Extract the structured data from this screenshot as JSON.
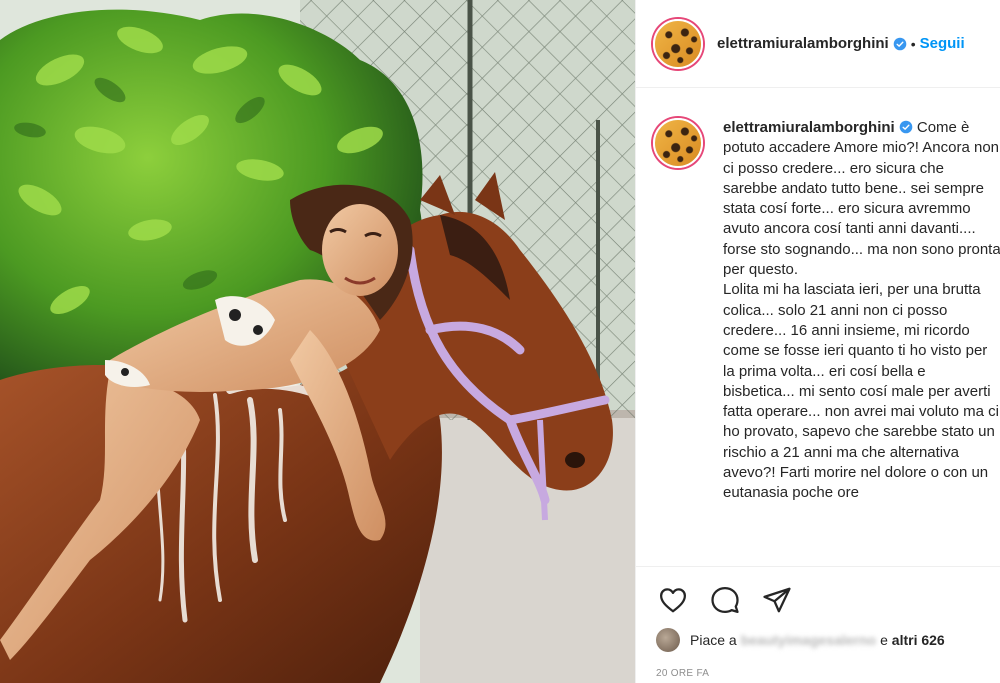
{
  "post": {
    "username": "elettramiuralamborghini",
    "separator": "•",
    "follow_label": "Seguii",
    "caption": "Come è potuto accadere Amore mio?! Ancora non ci posso credere... ero sicura che sarebbe andato tutto bene.. sei sempre stata cosí forte... ero sicura avremmo avuto ancora cosí tanti anni davanti.... forse sto sognando... ma non sono pronta per questo.\nLolita mi ha lasciata ieri, per una brutta colica... solo 21 anni non ci posso credere... 16 anni insieme, mi ricordo come se fosse ieri quanto ti ho visto per la prima volta... eri cosí bella e bisbetica... mi sento cosí male per averti fatta operare... non avrei mai voluto ma ci ho provato, sapevo che sarebbe stato un rischio a 21 anni ma che alternativa avevo?! Farti morire nel dolore o con un eutanasia poche ore",
    "likes": {
      "prefix": "Piace a",
      "liker": "beautyimagesalerno",
      "middle": "e",
      "others": "altri 626"
    },
    "timestamp": "20 ORE FA"
  },
  "icons": {
    "verified": "verified-badge-icon",
    "like": "heart-icon",
    "comment": "comment-icon",
    "share": "paper-plane-icon"
  },
  "colors": {
    "follow": "#0095f6",
    "verified": "#3897f0",
    "story_ring": "#e64778",
    "muted": "#8e8e8e"
  }
}
